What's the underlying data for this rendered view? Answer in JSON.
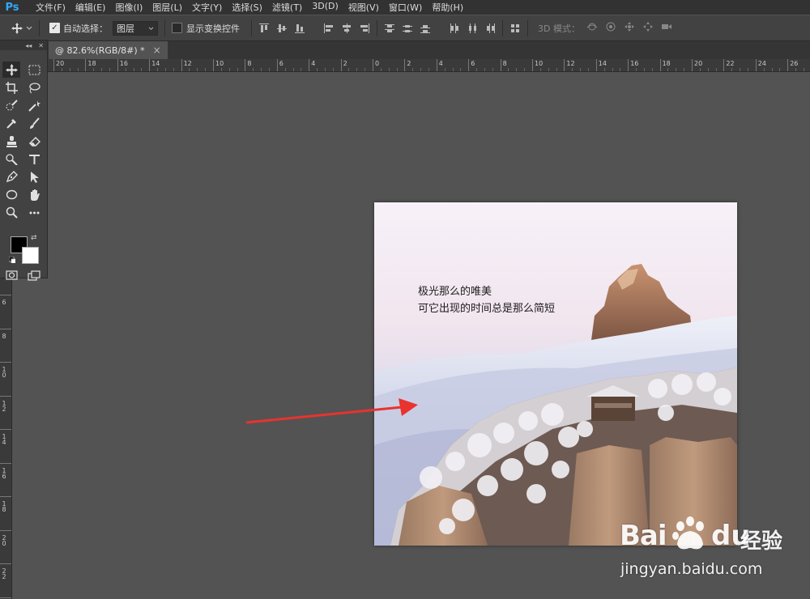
{
  "app": {
    "logo": "Ps"
  },
  "menu": [
    "文件(F)",
    "编辑(E)",
    "图像(I)",
    "图层(L)",
    "文字(Y)",
    "选择(S)",
    "滤镜(T)",
    "3D(D)",
    "视图(V)",
    "窗口(W)",
    "帮助(H)"
  ],
  "options": {
    "auto_select_label": "自动选择：",
    "auto_select_checked": true,
    "layer_dropdown_value": "图层",
    "show_transform_label": "显示变换控件",
    "show_transform_checked": false,
    "mode3d_label": "3D 模式："
  },
  "document": {
    "tab_title": "@ 82.6%(RGB/8#) *",
    "close_glyph": "×"
  },
  "ruler": {
    "h_labels": [
      "20",
      "18",
      "16",
      "14",
      "12",
      "10",
      "8",
      "6",
      "4",
      "2",
      "0",
      "2",
      "4",
      "6",
      "8",
      "10",
      "12",
      "14",
      "16",
      "18",
      "20",
      "22",
      "24",
      "26"
    ],
    "v_labels": [
      "6",
      "8",
      "10",
      "12",
      "14",
      "16",
      "18",
      "20",
      "22",
      "2"
    ]
  },
  "image": {
    "caption_line1": "极光那么的唯美",
    "caption_line2": "可它出现的时间总是那么简短"
  },
  "watermark": {
    "brand_left": "Bai",
    "brand_right": "du",
    "service": "经验",
    "url": "jingyan.baidu.com"
  },
  "colors": {
    "menu_bg": "#323232",
    "panel_bg": "#424242",
    "canvas_bg": "#535353",
    "ps_blue": "#31a8ff",
    "arrow_red": "#e8332e"
  },
  "toolbox": {
    "tools": [
      "move-tool",
      "marquee-tool",
      "crop-tool",
      "lasso-tool",
      "quick-select-tool",
      "magic-wand-tool",
      "eyedropper-tool",
      "brush-tool",
      "stamp-tool",
      "eraser-tool",
      "burn-tool",
      "type-tool",
      "pen-tool",
      "path-select-tool",
      "ellipse-tool",
      "hand-tool",
      "zoom-tool",
      "more-tools",
      "quick-mask",
      "screen-mode"
    ],
    "swap_glyph": "⇄"
  }
}
